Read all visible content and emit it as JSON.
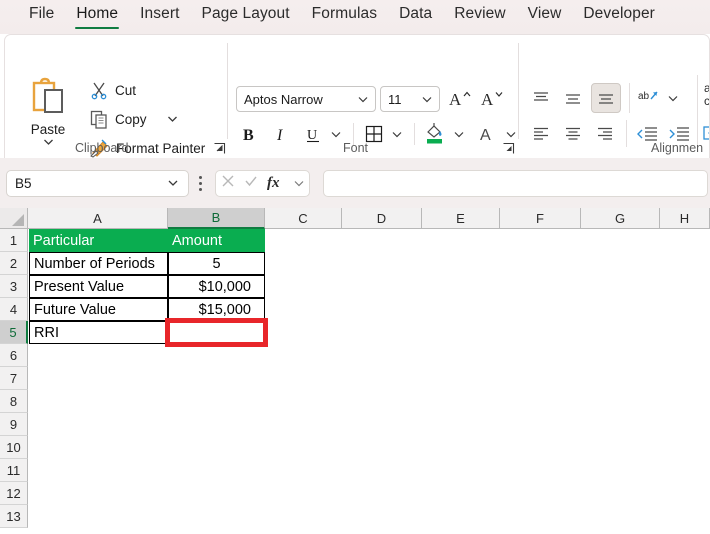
{
  "app": {
    "accent_green": "#107c41",
    "header_fill": "#0aad50",
    "annotation_color": "#e8262a"
  },
  "tabs": [
    {
      "label": "File",
      "active": false
    },
    {
      "label": "Home",
      "active": true
    },
    {
      "label": "Insert",
      "active": false
    },
    {
      "label": "Page Layout",
      "active": false
    },
    {
      "label": "Formulas",
      "active": false
    },
    {
      "label": "Data",
      "active": false
    },
    {
      "label": "Review",
      "active": false
    },
    {
      "label": "View",
      "active": false
    },
    {
      "label": "Developer",
      "active": false
    }
  ],
  "ribbon": {
    "clipboard": {
      "group_label": "Clipboard",
      "paste_label": "Paste",
      "cut_label": "Cut",
      "copy_label": "Copy",
      "format_painter_label": "Format Painter"
    },
    "font": {
      "group_label": "Font",
      "font_name": "Aptos Narrow",
      "font_size": "11"
    },
    "alignment": {
      "group_label": "Alignmen"
    }
  },
  "formula_bar": {
    "name_box_value": "B5",
    "formula_value": "",
    "formula_placeholder": ""
  },
  "sheet": {
    "columns": [
      "A",
      "B",
      "C",
      "D",
      "E",
      "F",
      "G",
      "H"
    ],
    "selected_column": "B",
    "rows": [
      "1",
      "2",
      "3",
      "4",
      "5",
      "6",
      "7",
      "8",
      "9",
      "10",
      "11",
      "12",
      "13"
    ],
    "selected_row": "5",
    "active_cell": "B5",
    "data": [
      {
        "row": "1",
        "a": "Particular",
        "b": "Amount",
        "style": "header"
      },
      {
        "row": "2",
        "a": "Number of Periods",
        "b": "5",
        "style": "data-center"
      },
      {
        "row": "3",
        "a": "Present Value",
        "b": "$10,000",
        "style": "data-right"
      },
      {
        "row": "4",
        "a": "Future Value",
        "b": "$15,000",
        "style": "data-right"
      },
      {
        "row": "5",
        "a": "RRI",
        "b": "",
        "style": "data-empty"
      }
    ]
  }
}
